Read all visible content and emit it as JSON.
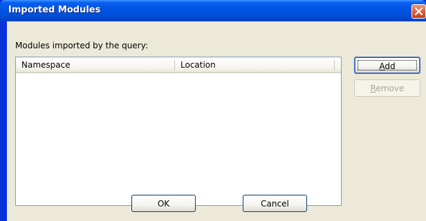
{
  "window": {
    "title": "Imported Modules"
  },
  "dialog": {
    "section_label": "Modules imported by the query:",
    "columns": [
      {
        "label": "Namespace"
      },
      {
        "label": "Location"
      }
    ],
    "rows": []
  },
  "buttons": {
    "add": {
      "mnemonic": "A",
      "rest": "dd",
      "enabled": true
    },
    "remove": {
      "mnemonic": "R",
      "rest": "emove",
      "enabled": false
    },
    "ok": {
      "label": "OK"
    },
    "cancel": {
      "label": "Cancel"
    }
  },
  "icons": {
    "close": "close-icon"
  },
  "colors": {
    "titlebar": "#0054e3",
    "dialog_face": "#ece9d8",
    "close_button": "#e0643d"
  }
}
